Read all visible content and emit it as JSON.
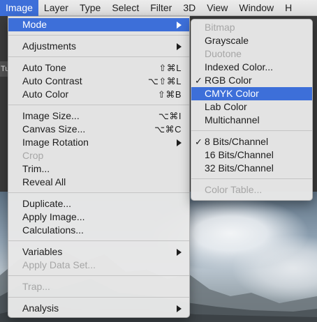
{
  "menubar": {
    "items": [
      {
        "label": "Image",
        "active": true
      },
      {
        "label": "Layer"
      },
      {
        "label": "Type"
      },
      {
        "label": "Select"
      },
      {
        "label": "Filter"
      },
      {
        "label": "3D"
      },
      {
        "label": "View"
      },
      {
        "label": "Window"
      },
      {
        "label": "H"
      }
    ]
  },
  "doc_tab": {
    "label": "Tu"
  },
  "image_menu": {
    "mode": "Mode",
    "adjustments": "Adjustments",
    "auto_tone": {
      "label": "Auto Tone",
      "shortcut": "⇧⌘L"
    },
    "auto_contrast": {
      "label": "Auto Contrast",
      "shortcut": "⌥⇧⌘L"
    },
    "auto_color": {
      "label": "Auto Color",
      "shortcut": "⇧⌘B"
    },
    "image_size": {
      "label": "Image Size...",
      "shortcut": "⌥⌘I"
    },
    "canvas_size": {
      "label": "Canvas Size...",
      "shortcut": "⌥⌘C"
    },
    "image_rotation": "Image Rotation",
    "crop": "Crop",
    "trim": "Trim...",
    "reveal_all": "Reveal All",
    "duplicate": "Duplicate...",
    "apply_image": "Apply Image...",
    "calculations": "Calculations...",
    "variables": "Variables",
    "apply_data_set": "Apply Data Set...",
    "trap": "Trap...",
    "analysis": "Analysis"
  },
  "mode_submenu": {
    "bitmap": "Bitmap",
    "grayscale": "Grayscale",
    "duotone": "Duotone",
    "indexed_color": "Indexed Color...",
    "rgb_color": "RGB Color",
    "cmyk_color": "CMYK Color",
    "lab_color": "Lab Color",
    "multichannel": "Multichannel",
    "bits_8": "8 Bits/Channel",
    "bits_16": "16 Bits/Channel",
    "bits_32": "32 Bits/Channel",
    "color_table": "Color Table...",
    "check_mark": "✓"
  },
  "colors": {
    "highlight": "#3d6fd9",
    "menu_bg": "#e8e8e8",
    "disabled_text": "#a6a6a6"
  }
}
